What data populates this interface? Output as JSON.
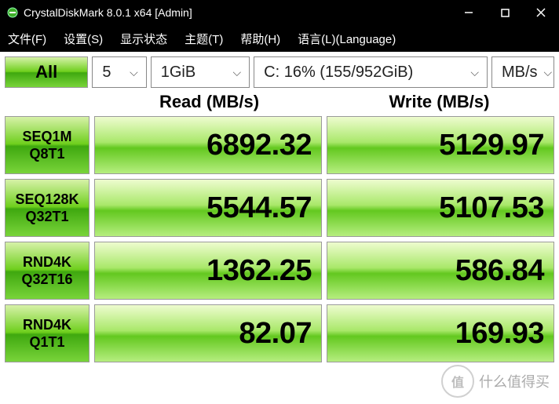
{
  "titlebar": {
    "title": "CrystalDiskMark 8.0.1 x64 [Admin]"
  },
  "menu": {
    "file": "文件(F)",
    "settings": "设置(S)",
    "display": "显示状态",
    "theme": "主题(T)",
    "help": "帮助(H)",
    "language": "语言(L)(Language)"
  },
  "toolbar": {
    "all": "All",
    "runs": "5",
    "size": "1GiB",
    "drive": "C: 16% (155/952GiB)",
    "unit": "MB/s"
  },
  "headers": {
    "read": "Read (MB/s)",
    "write": "Write (MB/s)"
  },
  "tests": [
    {
      "label1": "SEQ1M",
      "label2": "Q8T1",
      "read": "6892.32",
      "write": "5129.97"
    },
    {
      "label1": "SEQ128K",
      "label2": "Q32T1",
      "read": "5544.57",
      "write": "5107.53"
    },
    {
      "label1": "RND4K",
      "label2": "Q32T16",
      "read": "1362.25",
      "write": "586.84"
    },
    {
      "label1": "RND4K",
      "label2": "Q1T1",
      "read": "82.07",
      "write": "169.93"
    }
  ],
  "watermark": {
    "badge": "值",
    "text": "什么值得买"
  }
}
